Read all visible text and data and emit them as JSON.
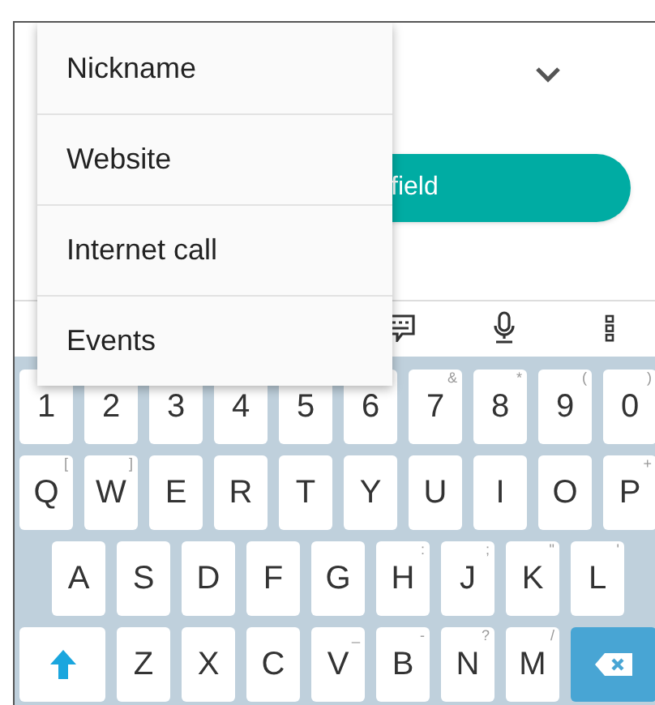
{
  "menu": {
    "items": [
      {
        "label": "Nickname"
      },
      {
        "label": "Website"
      },
      {
        "label": "Internet call"
      },
      {
        "label": "Events"
      }
    ]
  },
  "form": {
    "add_button": "field"
  },
  "keyboard": {
    "rows": [
      [
        {
          "kind": "char",
          "label": "1"
        },
        {
          "kind": "char",
          "label": "2"
        },
        {
          "kind": "char",
          "label": "3"
        },
        {
          "kind": "char",
          "label": "4"
        },
        {
          "kind": "char",
          "label": "5"
        },
        {
          "kind": "char",
          "label": "6"
        },
        {
          "kind": "char",
          "label": "7",
          "hint": "&"
        },
        {
          "kind": "char",
          "label": "8",
          "hint": "*"
        },
        {
          "kind": "char",
          "label": "9",
          "hint": "("
        },
        {
          "kind": "char",
          "label": "0",
          "hint": ")"
        }
      ],
      [
        {
          "kind": "char",
          "label": "Q",
          "hint": "["
        },
        {
          "kind": "char",
          "label": "W",
          "hint": "]"
        },
        {
          "kind": "char",
          "label": "E"
        },
        {
          "kind": "char",
          "label": "R"
        },
        {
          "kind": "char",
          "label": "T"
        },
        {
          "kind": "char",
          "label": "Y"
        },
        {
          "kind": "char",
          "label": "U"
        },
        {
          "kind": "char",
          "label": "I"
        },
        {
          "kind": "char",
          "label": "O"
        },
        {
          "kind": "char",
          "label": "P",
          "hint": "+"
        }
      ],
      [
        {
          "kind": "char",
          "label": "A"
        },
        {
          "kind": "char",
          "label": "S"
        },
        {
          "kind": "char",
          "label": "D"
        },
        {
          "kind": "char",
          "label": "F"
        },
        {
          "kind": "char",
          "label": "G"
        },
        {
          "kind": "char",
          "label": "H",
          "hint": ":"
        },
        {
          "kind": "char",
          "label": "J",
          "hint": ";"
        },
        {
          "kind": "char",
          "label": "K",
          "hint": "\""
        },
        {
          "kind": "char",
          "label": "L",
          "hint": "'"
        }
      ],
      [
        {
          "kind": "shift"
        },
        {
          "kind": "char",
          "label": "Z"
        },
        {
          "kind": "char",
          "label": "X"
        },
        {
          "kind": "char",
          "label": "C"
        },
        {
          "kind": "char",
          "label": "V",
          "hint": "_"
        },
        {
          "kind": "char",
          "label": "B",
          "hint": "-"
        },
        {
          "kind": "char",
          "label": "N",
          "hint": "?"
        },
        {
          "kind": "char",
          "label": "M",
          "hint": "/"
        },
        {
          "kind": "backspace"
        }
      ]
    ]
  }
}
